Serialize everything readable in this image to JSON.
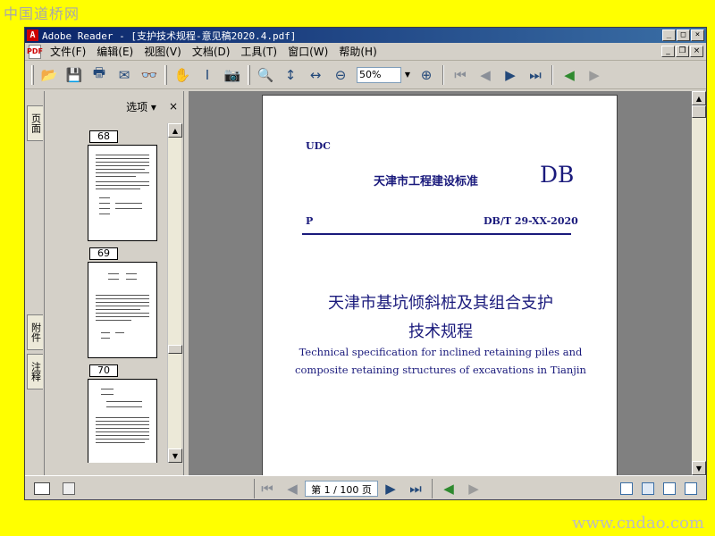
{
  "watermarks": {
    "top": "中国道桥网",
    "bottom": "www.cndao.com"
  },
  "window": {
    "title": "Adobe Reader - [支护技术规程-意见稿2020.4.pdf]",
    "app_icon_glyph": "A",
    "controls": {
      "minimize": "_",
      "maximize": "□",
      "close": "×",
      "doc_minimize": "_",
      "doc_restore": "❐",
      "doc_close": "×"
    }
  },
  "menu": {
    "doc_icon_glyph": "PDF",
    "items": [
      "文件(F)",
      "编辑(E)",
      "视图(V)",
      "文档(D)",
      "工具(T)",
      "窗口(W)",
      "帮助(H)"
    ]
  },
  "toolbar": {
    "open_icon": "open-icon",
    "save_icon": "save-icon",
    "print_icon": "print-icon",
    "email_icon": "email-icon",
    "search_icon": "binoculars-icon",
    "hand_icon": "hand-icon",
    "select_icon": "text-select-icon",
    "snapshot_icon": "snapshot-icon",
    "zoom_in_icon": "zoom-in-icon",
    "fit_page_icon": "fit-page-icon",
    "fit_width_icon": "fit-width-icon",
    "zoom_out_icon": "zoom-out-icon",
    "zoom_value": "50%",
    "zoom_drop_glyph": "▼",
    "glyphs": {
      "open": "📂",
      "save": "💾",
      "print": "🖶",
      "email": "✉",
      "binoculars": "👓",
      "hand": "✋",
      "select": "I",
      "snapshot": "📷",
      "zoom_in": "🔍",
      "fit_page": "↕",
      "fit_width": "↔",
      "zoom_out": "⊖",
      "zoom_plus": "⊕",
      "first": "⏮",
      "prev": "◀",
      "next": "▶",
      "last": "⏭",
      "back": "◀",
      "forward": "▶"
    }
  },
  "nav_tabs": {
    "pages": "页面",
    "attachments": "附件",
    "comments": "注释"
  },
  "panel": {
    "options_label": "选项 ▾",
    "close_glyph": "×",
    "thumbnails": [
      {
        "label": "68"
      },
      {
        "label": "69"
      },
      {
        "label": "70"
      }
    ]
  },
  "document": {
    "udc": "UDC",
    "standard_name": "天津市工程建设标准",
    "db": "DB",
    "p": "P",
    "code": "DB/T 29-XX-2020",
    "title_cn_1": "天津市基坑倾斜桩及其组合支护",
    "title_cn_2": "技术规程",
    "title_en_1": "Technical specification for inclined retaining piles and",
    "title_en_2": "composite retaining structures of excavations in Tianjin"
  },
  "statusbar": {
    "page_display": "第 1 / 100 页",
    "glyphs": {
      "first": "⏮",
      "prev": "◀",
      "next": "▶",
      "last": "⏭",
      "back": "◀",
      "forward": "▶"
    }
  },
  "colors": {
    "watermark_bg": "#ffff00",
    "title_bar": "#0a246a",
    "doc_text": "#1a1a7c",
    "nav_blue": "#23497a",
    "nav_green": "#2f8a2f"
  }
}
